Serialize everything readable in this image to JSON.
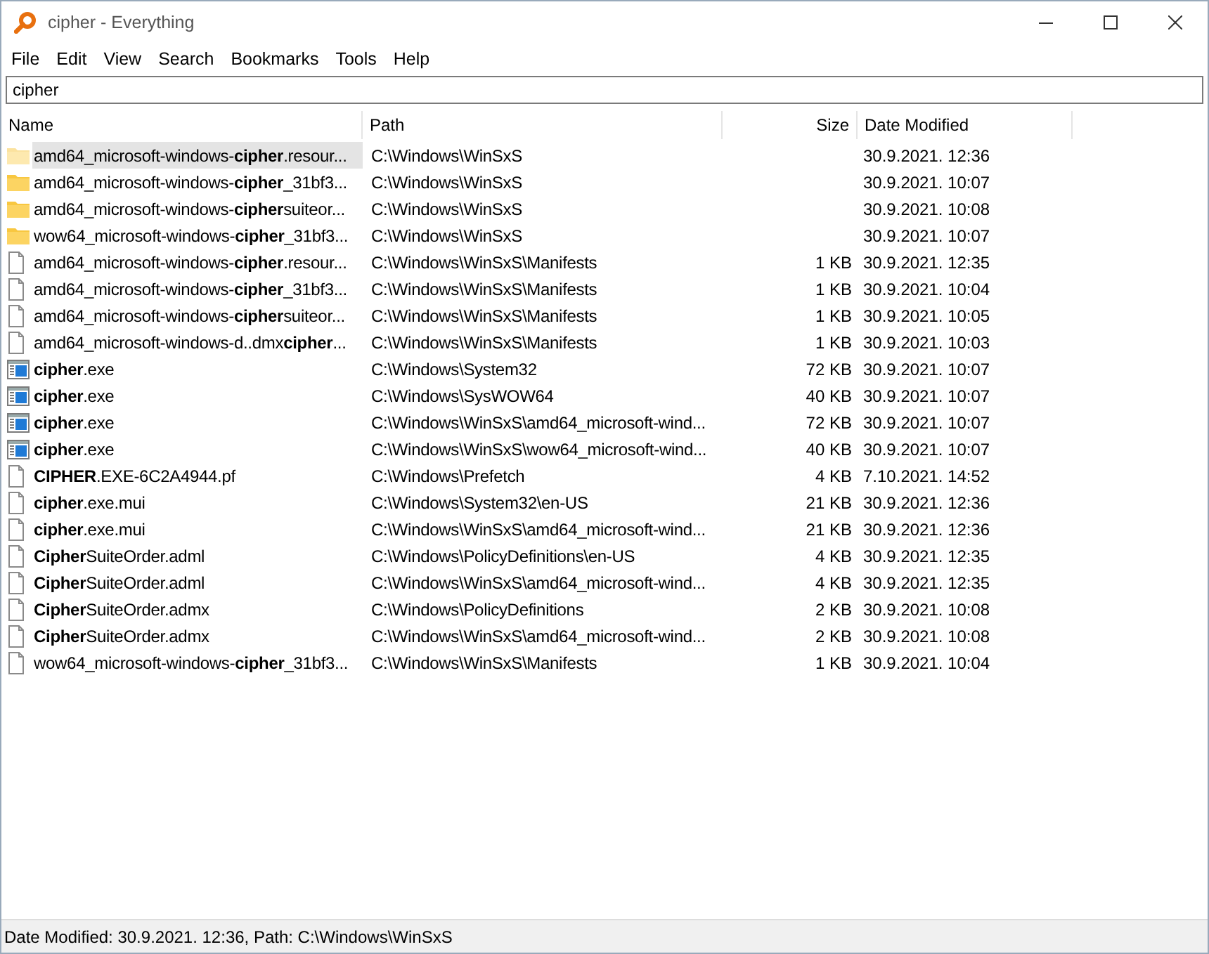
{
  "window": {
    "title": "cipher - Everything"
  },
  "menu": [
    "File",
    "Edit",
    "View",
    "Search",
    "Bookmarks",
    "Tools",
    "Help"
  ],
  "search": {
    "value": "cipher"
  },
  "table": {
    "columns": [
      "Name",
      "Path",
      "Size",
      "Date Modified"
    ],
    "rows": [
      {
        "kind": "folder",
        "selected": true,
        "name": "amd64_microsoft-windows-**cipher**.resour...",
        "path": "C:\\Windows\\WinSxS",
        "size": "",
        "date": "30.9.2021. 12:36"
      },
      {
        "kind": "folder",
        "selected": false,
        "name": "amd64_microsoft-windows-**cipher**_31bf3...",
        "path": "C:\\Windows\\WinSxS",
        "size": "",
        "date": "30.9.2021. 10:07"
      },
      {
        "kind": "folder",
        "selected": false,
        "name": "amd64_microsoft-windows-**cipher**suiteor...",
        "path": "C:\\Windows\\WinSxS",
        "size": "",
        "date": "30.9.2021. 10:08"
      },
      {
        "kind": "folder",
        "selected": false,
        "name": "wow64_microsoft-windows-**cipher**_31bf3...",
        "path": "C:\\Windows\\WinSxS",
        "size": "",
        "date": "30.9.2021. 10:07"
      },
      {
        "kind": "file",
        "selected": false,
        "name": "amd64_microsoft-windows-**cipher**.resour...",
        "path": "C:\\Windows\\WinSxS\\Manifests",
        "size": "1 KB",
        "date": "30.9.2021. 12:35"
      },
      {
        "kind": "file",
        "selected": false,
        "name": "amd64_microsoft-windows-**cipher**_31bf3...",
        "path": "C:\\Windows\\WinSxS\\Manifests",
        "size": "1 KB",
        "date": "30.9.2021. 10:04"
      },
      {
        "kind": "file",
        "selected": false,
        "name": "amd64_microsoft-windows-**cipher**suiteor...",
        "path": "C:\\Windows\\WinSxS\\Manifests",
        "size": "1 KB",
        "date": "30.9.2021. 10:05"
      },
      {
        "kind": "file",
        "selected": false,
        "name": "amd64_microsoft-windows-d..dmx**cipher**...",
        "path": "C:\\Windows\\WinSxS\\Manifests",
        "size": "1 KB",
        "date": "30.9.2021. 10:03"
      },
      {
        "kind": "exe",
        "selected": false,
        "name": "**cipher**.exe",
        "path": "C:\\Windows\\System32",
        "size": "72 KB",
        "date": "30.9.2021. 10:07"
      },
      {
        "kind": "exe",
        "selected": false,
        "name": "**cipher**.exe",
        "path": "C:\\Windows\\SysWOW64",
        "size": "40 KB",
        "date": "30.9.2021. 10:07"
      },
      {
        "kind": "exe",
        "selected": false,
        "name": "**cipher**.exe",
        "path": "C:\\Windows\\WinSxS\\amd64_microsoft-wind...",
        "size": "72 KB",
        "date": "30.9.2021. 10:07"
      },
      {
        "kind": "exe",
        "selected": false,
        "name": "**cipher**.exe",
        "path": "C:\\Windows\\WinSxS\\wow64_microsoft-wind...",
        "size": "40 KB",
        "date": "30.9.2021. 10:07"
      },
      {
        "kind": "file",
        "selected": false,
        "name": "**CIPHER**.EXE-6C2A4944.pf",
        "path": "C:\\Windows\\Prefetch",
        "size": "4 KB",
        "date": "7.10.2021. 14:52"
      },
      {
        "kind": "file",
        "selected": false,
        "name": "**cipher**.exe.mui",
        "path": "C:\\Windows\\System32\\en-US",
        "size": "21 KB",
        "date": "30.9.2021. 12:36"
      },
      {
        "kind": "file",
        "selected": false,
        "name": "**cipher**.exe.mui",
        "path": "C:\\Windows\\WinSxS\\amd64_microsoft-wind...",
        "size": "21 KB",
        "date": "30.9.2021. 12:36"
      },
      {
        "kind": "file",
        "selected": false,
        "name": "**Cipher**SuiteOrder.adml",
        "path": "C:\\Windows\\PolicyDefinitions\\en-US",
        "size": "4 KB",
        "date": "30.9.2021. 12:35"
      },
      {
        "kind": "file",
        "selected": false,
        "name": "**Cipher**SuiteOrder.adml",
        "path": "C:\\Windows\\WinSxS\\amd64_microsoft-wind...",
        "size": "4 KB",
        "date": "30.9.2021. 12:35"
      },
      {
        "kind": "file",
        "selected": false,
        "name": "**Cipher**SuiteOrder.admx",
        "path": "C:\\Windows\\PolicyDefinitions",
        "size": "2 KB",
        "date": "30.9.2021. 10:08"
      },
      {
        "kind": "file",
        "selected": false,
        "name": "**Cipher**SuiteOrder.admx",
        "path": "C:\\Windows\\WinSxS\\amd64_microsoft-wind...",
        "size": "2 KB",
        "date": "30.9.2021. 10:08"
      },
      {
        "kind": "file",
        "selected": false,
        "name": "wow64_microsoft-windows-**cipher**_31bf3...",
        "path": "C:\\Windows\\WinSxS\\Manifests",
        "size": "1 KB",
        "date": "30.9.2021. 10:04"
      }
    ]
  },
  "status_bar": "Date Modified: 30.9.2021. 12:36, Path: C:\\Windows\\WinSxS"
}
